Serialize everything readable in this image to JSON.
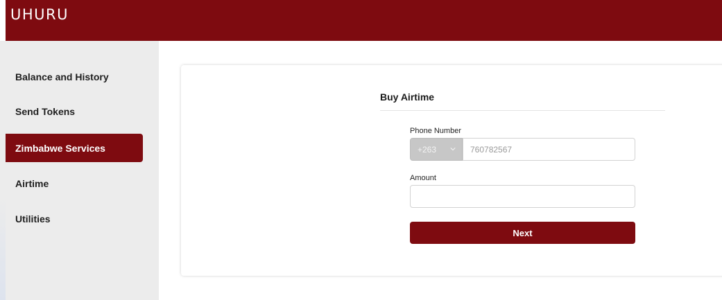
{
  "app": {
    "logo": "UHURU",
    "brand_color": "#7e0b10"
  },
  "sidebar": {
    "items": [
      {
        "label": "Balance and History",
        "active": false
      },
      {
        "label": "Send Tokens",
        "active": false
      },
      {
        "label": "Zimbabwe Services",
        "active": true
      },
      {
        "label": "Airtime",
        "active": false
      },
      {
        "label": "Utilities",
        "active": false
      }
    ]
  },
  "form": {
    "title": "Buy Airtime",
    "phone": {
      "label": "Phone Number",
      "country_code": "+263",
      "placeholder": "760782567",
      "value": ""
    },
    "amount": {
      "label": "Amount",
      "value": ""
    },
    "next_label": "Next"
  },
  "icons": {
    "country_dropdown": "chevron-down-icon"
  }
}
